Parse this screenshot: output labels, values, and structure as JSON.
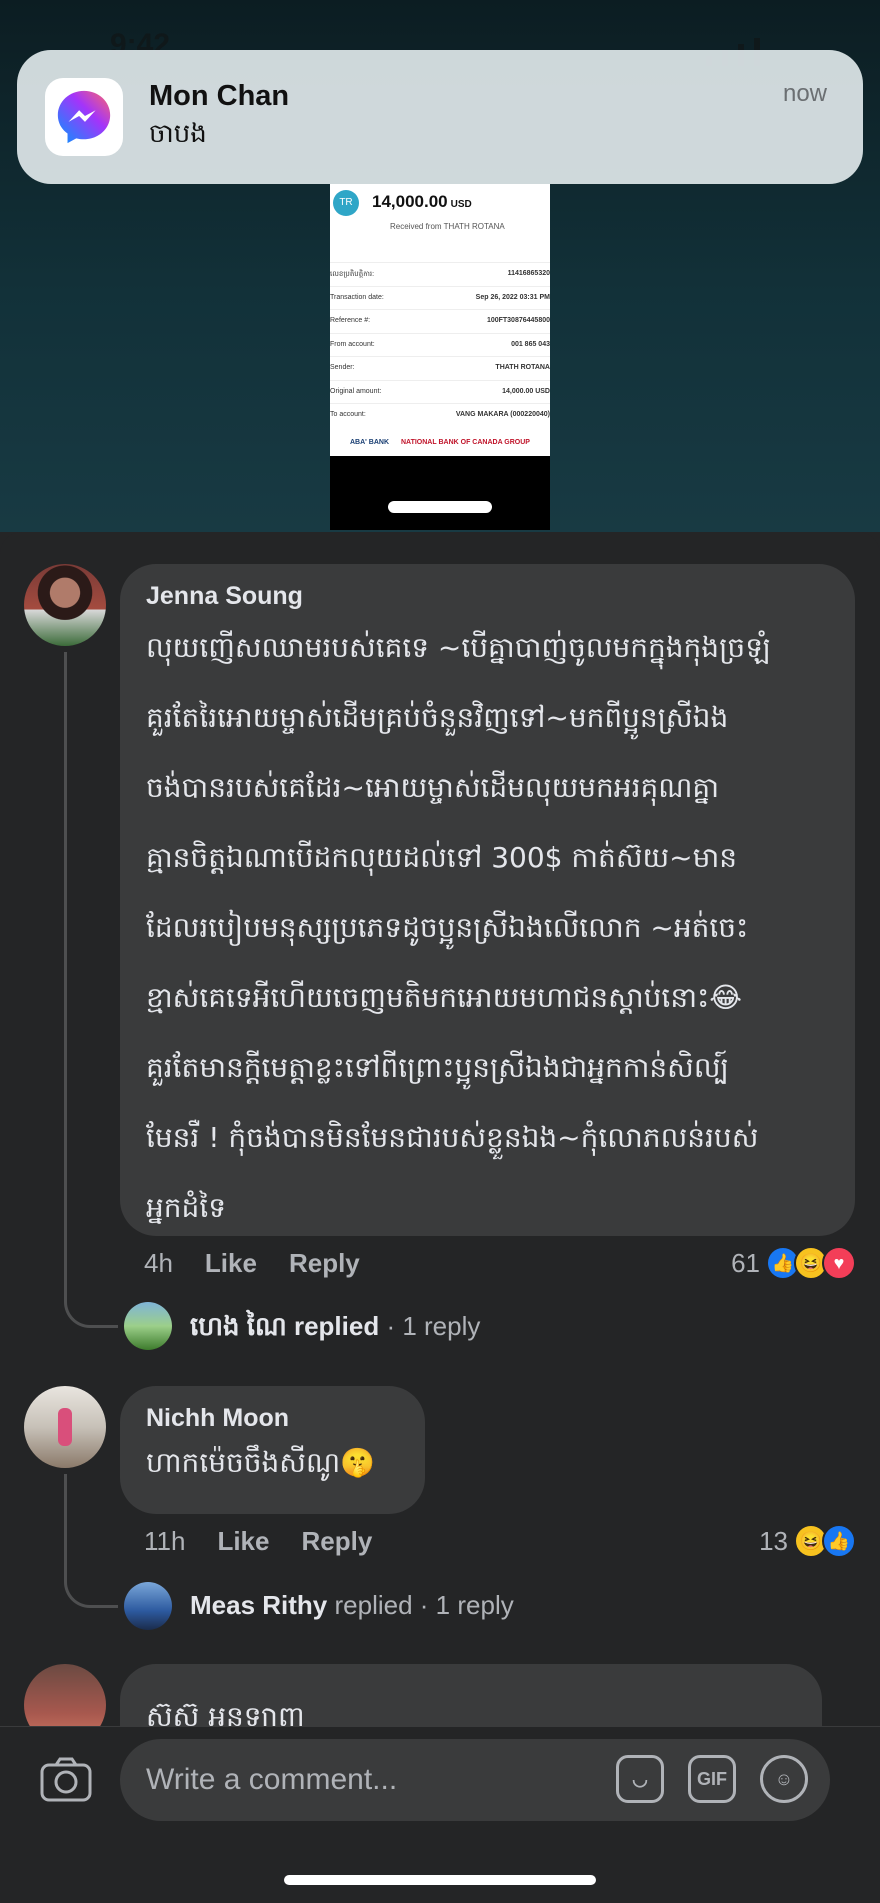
{
  "status_bar": {
    "time": "9:42",
    "battery": "40"
  },
  "notification": {
    "app_icon": "messenger-icon",
    "title": "Mon Chan",
    "body": "ចាបង",
    "time": "now"
  },
  "receipt": {
    "logo_text": "TR",
    "amount": "14,000.00",
    "currency": "USD",
    "received_from": "Received from THATH ROTANA",
    "rows": [
      {
        "label": "លេខប្រតិបត្តិការ:",
        "value": "11416865320"
      },
      {
        "label": "Transaction date:",
        "value": "Sep 26, 2022 03:31 PM"
      },
      {
        "label": "Reference #:",
        "value": "100FT30876445800"
      },
      {
        "label": "From account:",
        "value": "001 865 043"
      },
      {
        "label": "Sender:",
        "value": "THATH ROTANA"
      },
      {
        "label": "Original amount:",
        "value": "14,000.00 USD"
      },
      {
        "label": "To account:",
        "value": "VANG MAKARA (000220040)"
      }
    ],
    "bank": "ABA' BANK",
    "partner": "NATIONAL BANK OF CANADA GROUP"
  },
  "comments": [
    {
      "author": "Jenna Soung",
      "text": "លុយញើសឈាមរបស់គេទេ ~បើគ្នាបាញ់ចូលមកក្នុងកុងច្រឡំ\nគួរតែរៃអោយម្ចាស់ដើមគ្រប់ចំនួនវិញទៅ~មកពីប្អូនស្រីឯង\nចង់បានរបស់គេដែរ~អោយម្ចាស់ដើមលុយមកអរគុណគ្នា\nគ្មានចិត្តឯណាបើដកលុយដល់ទៅ 300$ កាត់ស៊យ~មាន\nដែលរបៀបមនុស្សប្រភេទដូចប្អូនស្រីឯងលើលោក ~អត់ចេះ\nខ្មាស់គេទេអីហើយចេញមតិមកអោយមហាជនស្តាប់នោះ😂\nគួរតែមានក្តីមេត្តាខ្លះទៅពីព្រោះប្អូនស្រីឯងជាអ្នកកាន់សិល្ប៍\nមែនរឺ ! កុំចង់បានមិនមែនជារបស់ខ្លួនឯង~កុំលោភលន់របស់\nអ្នកដំទៃ",
      "time": "4h",
      "like": "Like",
      "reply": "Reply",
      "reaction_count": "61",
      "replies": {
        "name": "ហេង ណៃ",
        "verb": "replied",
        "count": "· 1 reply"
      }
    },
    {
      "author": "Nichh Moon",
      "text": "ហាកម៉េចចឹងសីណូ🤫",
      "time": "11h",
      "like": "Like",
      "reply": "Reply",
      "reaction_count": "13",
      "replies": {
        "name": "Meas Rithy",
        "verb": "replied",
        "count": "· 1 reply"
      }
    },
    {
      "author": "",
      "text": "ស៊ូស៊ូ អនឡាញ"
    }
  ],
  "composer": {
    "placeholder": "Write a comment...",
    "gif_label": "GIF"
  },
  "colors": {
    "like": "#1877f2",
    "haha": "#f7c21f",
    "love": "#f33e58"
  }
}
